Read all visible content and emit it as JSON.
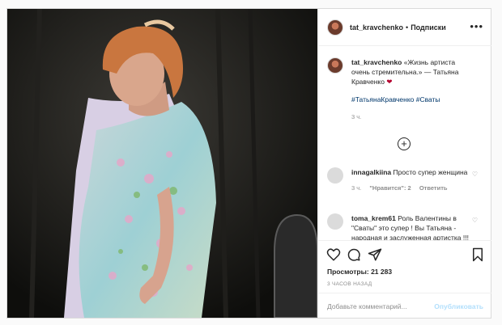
{
  "header": {
    "username": "tat_kravchenko",
    "separator": "•",
    "follow_label": "Подписки",
    "more_icon": "more-horizontal-icon"
  },
  "caption": {
    "username": "tat_kravchenko",
    "text": "«Жизнь артиста очень стремительна.» — Татьяна Кравченко",
    "heart": "❤",
    "hashtags": "#ТатьянаКравченко #Сваты",
    "time": "3 ч."
  },
  "load_more_icon": "plus-circle-icon",
  "comments": [
    {
      "username": "innagalkiina",
      "text": "Просто супер женщина",
      "time": "3 ч.",
      "likes": "\"Нравится\": 2",
      "reply": "Ответить"
    },
    {
      "username": "toma_krem61",
      "text": "Роль Валентины в \"Сваты\" это супер ! Вы Татьяна - народная и заслуженная артистка !!! Вы наша ! ❤❤❤❤"
    }
  ],
  "actions": {
    "like_icon": "heart-outline-icon",
    "comment_icon": "comment-icon",
    "share_icon": "paper-plane-icon",
    "save_icon": "bookmark-icon"
  },
  "views": "Просмотры: 21 283",
  "posted_ago": "3 ЧАСОВ НАЗАД",
  "add_comment": {
    "placeholder": "Добавьте комментарий...",
    "publish_label": "Опубликовать"
  }
}
